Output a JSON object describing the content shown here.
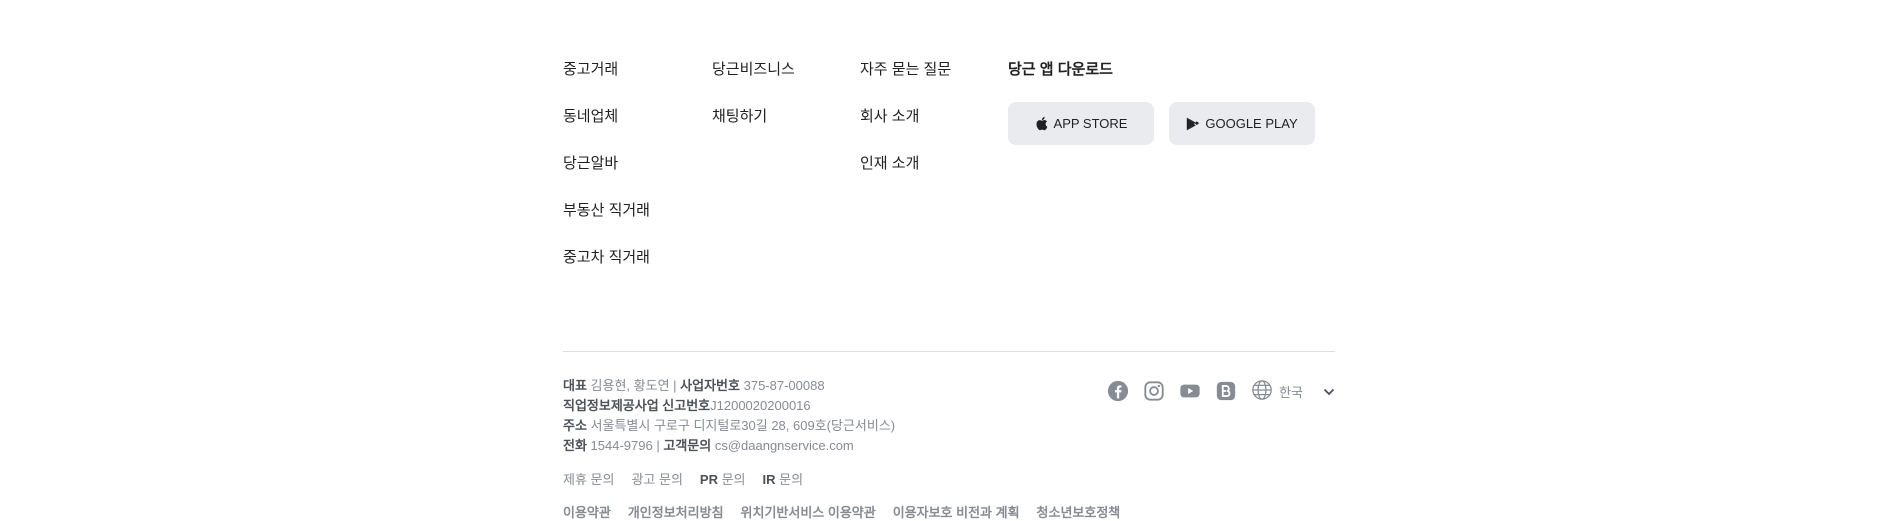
{
  "footer": {
    "column1": [
      "중고거래",
      "동네업체",
      "당근알바",
      "부동산 직거래",
      "중고차 직거래"
    ],
    "column2": [
      "당근비즈니스",
      "채팅하기"
    ],
    "column3": [
      "자주 묻는 질문",
      "회사 소개",
      "인재 소개"
    ],
    "download": {
      "title": "당근 앱 다운로드",
      "app_store_label": "APP STORE",
      "google_play_label": "GOOGLE PLAY"
    },
    "company": {
      "ceo_label": "대표",
      "ceo_value": "김용현, 황도연",
      "biz_no_label": "사업자번호",
      "biz_no_value": "375-87-00088",
      "separator": "|",
      "report_label": "직업정보제공사업 신고번호",
      "report_value": "J1200020200016",
      "address_label": "주소",
      "address_value": "서울특별시 구로구 디지털로30길 28, 609호(당근서비스)",
      "phone_label": "전화",
      "phone_value": "1544-9796",
      "support_label": "고객문의",
      "support_value": "cs@daangnservice.com"
    },
    "social_icons": [
      "facebook-icon",
      "instagram-icon",
      "youtube-icon",
      "blog-icon"
    ],
    "language": "한국",
    "inquiries": [
      {
        "prefix": "",
        "text": "제휴 문의"
      },
      {
        "prefix": "",
        "text": "광고 문의"
      },
      {
        "prefix": "PR",
        "text": " 문의"
      },
      {
        "prefix": "IR",
        "text": " 문의"
      }
    ],
    "policies": [
      "이용약관",
      "개인정보처리방침",
      "위치기반서비스 이용약관",
      "이용자보호 비전과 계획",
      "청소년보호정책"
    ]
  },
  "colors": {
    "text": "#212124",
    "muted": "#868b94",
    "button_bg": "#eaebee",
    "divider": "#dcdee3"
  }
}
